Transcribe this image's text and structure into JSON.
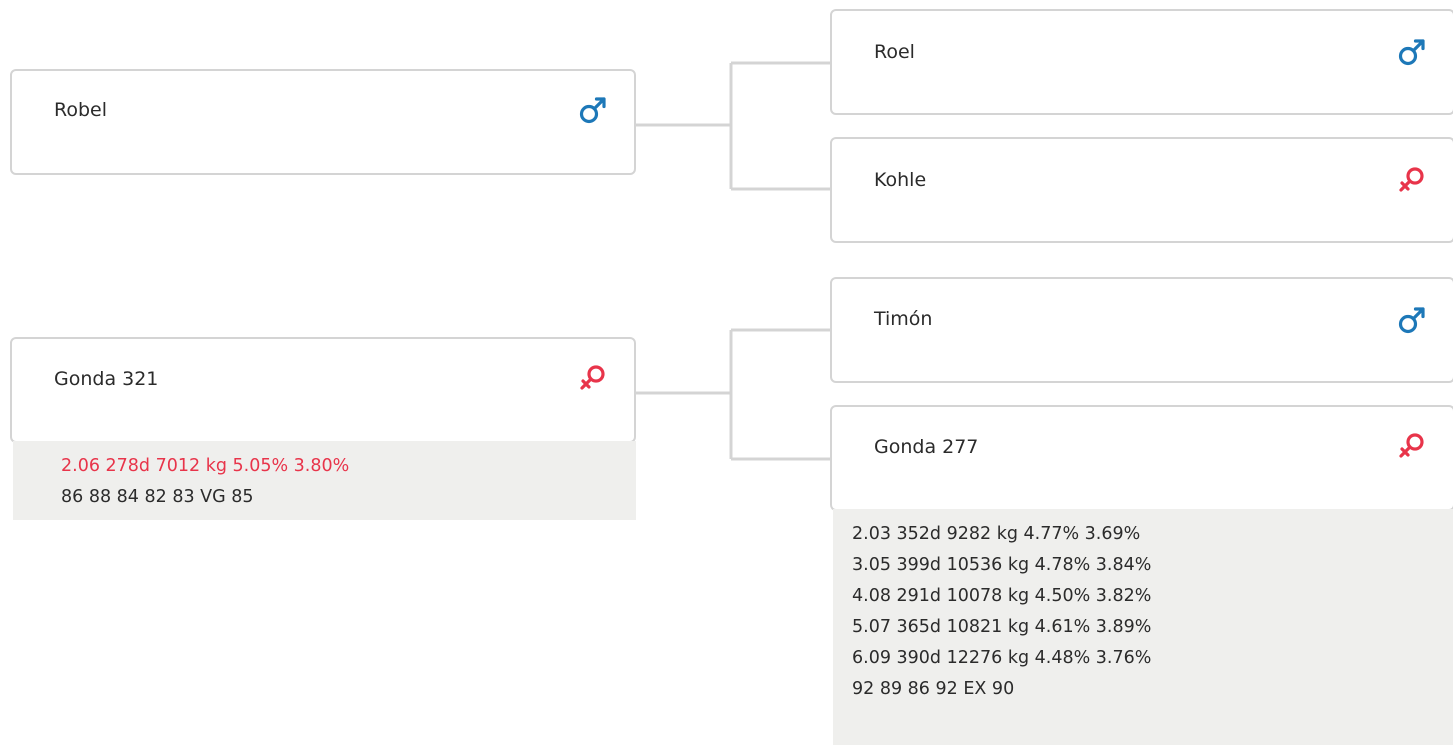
{
  "colors": {
    "male": "#1d78b8",
    "female": "#e8344a",
    "border": "#d4d4d4",
    "connector": "#d4d4d4",
    "info_bg": "#efefed",
    "highlight_text": "#e8344a",
    "text": "#2b2b2b"
  },
  "pedigree": {
    "sire": {
      "name": "Robel",
      "sex": "male",
      "sex_icon": "male-symbol-icon",
      "sire": {
        "name": "Roel",
        "sex": "male",
        "sex_icon": "male-symbol-icon"
      },
      "dam": {
        "name": "Kohle",
        "sex": "female",
        "sex_icon": "female-symbol-icon"
      }
    },
    "dam": {
      "name": "Gonda 321",
      "sex": "female",
      "sex_icon": "female-symbol-icon",
      "records": [
        {
          "text": "2.06 278d 7012 kg 5.05% 3.80%",
          "highlight": true
        },
        {
          "text": "86 88 84 82 83 VG 85",
          "highlight": false
        }
      ],
      "sire": {
        "name": "Timón",
        "sex": "male",
        "sex_icon": "male-symbol-icon"
      },
      "dam": {
        "name": "Gonda 277",
        "sex": "female",
        "sex_icon": "female-symbol-icon",
        "records": [
          {
            "text": "2.03 352d 9282 kg 4.77% 3.69%",
            "highlight": false
          },
          {
            "text": "3.05 399d 10536 kg 4.78% 3.84%",
            "highlight": false
          },
          {
            "text": "4.08 291d 10078 kg 4.50% 3.82%",
            "highlight": false
          },
          {
            "text": "5.07 365d 10821 kg 4.61% 3.89%",
            "highlight": false
          },
          {
            "text": "6.09 390d 12276 kg 4.48% 3.76%",
            "highlight": false
          },
          {
            "text": "92 89 86 92 EX 90",
            "highlight": false
          }
        ]
      }
    }
  }
}
